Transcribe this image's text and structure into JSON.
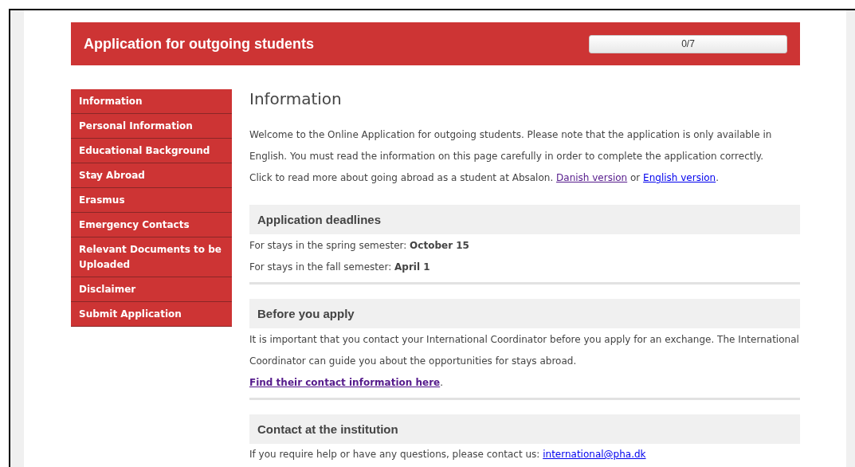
{
  "header": {
    "title": "Application for outgoing students",
    "progress": {
      "label": "0/7",
      "level": 0
    }
  },
  "sidebar": {
    "items": [
      {
        "label": "Information"
      },
      {
        "label": "Personal Information"
      },
      {
        "label": "Educational Background"
      },
      {
        "label": "Stay Abroad"
      },
      {
        "label": "Erasmus"
      },
      {
        "label": "Emergency Contacts"
      },
      {
        "label": "Relevant Documents to be Uploaded"
      },
      {
        "label": "Disclaimer"
      },
      {
        "label": "Submit Application"
      }
    ]
  },
  "content": {
    "title": "Information",
    "intro": [
      {
        "parts": [
          {
            "kind": "text",
            "text": "Welcome to the Online Application for outgoing students. Please note that the application is only available in English. You must read the information on this page carefully in order to complete the application correctly."
          }
        ]
      },
      {
        "parts": [
          {
            "kind": "text",
            "text": "Click to read more about going abroad as a student at Absalon. "
          },
          {
            "kind": "link",
            "text": "Danish version",
            "visited": true
          },
          {
            "kind": "text",
            "text": " or "
          },
          {
            "kind": "link",
            "text": "English version",
            "visited": false
          },
          {
            "kind": "text",
            "text": "."
          }
        ]
      }
    ],
    "sections": [
      {
        "heading": "Application deadlines",
        "paragraphs": [
          {
            "parts": [
              {
                "kind": "text",
                "text": "For stays in the spring semester: **October 15**"
              }
            ]
          },
          {
            "parts": [
              {
                "kind": "text",
                "text": "For stays in the fall semester: **April 1**"
              }
            ]
          }
        ]
      },
      {
        "heading": "Before you apply",
        "paragraphs": [
          {
            "parts": [
              {
                "kind": "text",
                "text": "It is important that you contact your International Coordinator before you apply for an exchange. The International Coordinator can guide you about the opportunities for stays abroad."
              }
            ]
          },
          {
            "parts": [
              {
                "kind": "link",
                "text": "Find their contact information here",
                "visited": true,
                "bold": true
              },
              {
                "kind": "text",
                "text": "."
              }
            ]
          }
        ]
      },
      {
        "heading": "Contact at the institution",
        "paragraphs": [
          {
            "parts": [
              {
                "kind": "text",
                "text": "If you require help or have any questions, please contact us: "
              },
              {
                "kind": "link",
                "text": "international@pha.dk",
                "visited": false
              }
            ]
          }
        ]
      }
    ]
  }
}
